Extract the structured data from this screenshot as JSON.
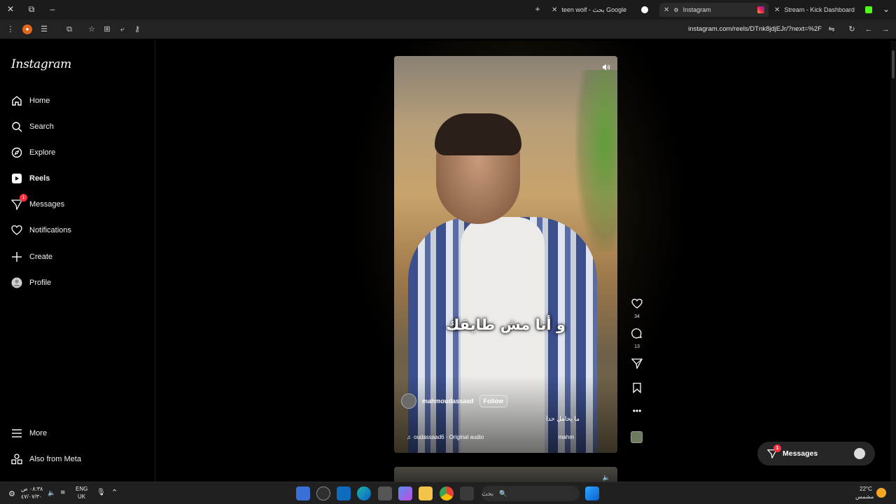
{
  "browser": {
    "tabs": [
      {
        "title": "teen wolf - بحث Google",
        "active": false
      },
      {
        "title": "Instagram",
        "active": true
      },
      {
        "title": "Stream - Kick Dashboard",
        "active": false
      }
    ],
    "url": "instagram.com/reels/DTnk8jdjEJr/?next=%2F"
  },
  "sidebar": {
    "logo": "Instagram",
    "items": [
      {
        "label": "Home",
        "icon": "home-icon"
      },
      {
        "label": "Search",
        "icon": "search-icon"
      },
      {
        "label": "Explore",
        "icon": "compass-icon"
      },
      {
        "label": "Reels",
        "icon": "reels-icon",
        "active": true
      },
      {
        "label": "Messages",
        "icon": "messenger-icon",
        "badge": "1"
      },
      {
        "label": "Notifications",
        "icon": "heart-icon"
      },
      {
        "label": "Create",
        "icon": "plus-icon"
      },
      {
        "label": "Profile",
        "icon": "avatar-icon"
      }
    ],
    "more": "More",
    "meta": "Also from Meta"
  },
  "reel": {
    "caption": "و أنا مش طايقك",
    "username": "mahmoudassaad",
    "follow": "Follow",
    "description": "ما يحامل حدا",
    "audio": "oudassaad6 · Original audio",
    "audio_right": "mahm",
    "likes": "34",
    "comments": "13"
  },
  "messages_pill": {
    "label": "Messages",
    "badge": "1"
  },
  "taskbar": {
    "time": "٠٨:٣٨ ص",
    "date": "٤٧/٠٧/٣٠",
    "lang_top": "ENG",
    "lang_bottom": "UK",
    "search_placeholder": "بحث",
    "temp": "22°C",
    "weather": "مشمس"
  }
}
